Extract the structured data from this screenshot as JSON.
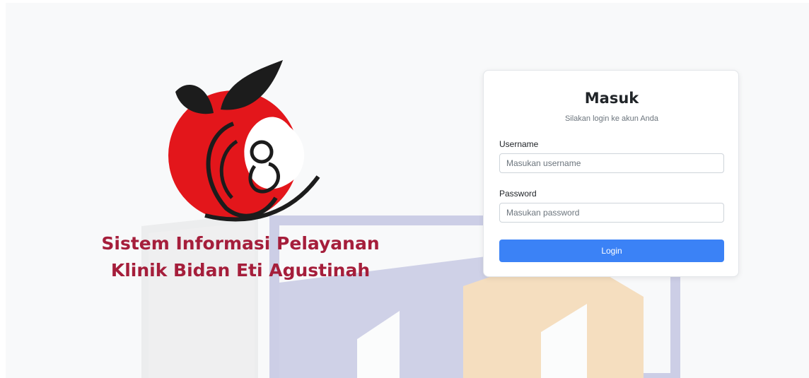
{
  "branding": {
    "line1": "Sistem Informasi Pelayanan",
    "line2": "Klinik Bidan Eti Agustinah",
    "brand_color": "#a51e3b",
    "logo_red": "#e3161b",
    "logo_dark": "#1c1c1c"
  },
  "login": {
    "title": "Masuk",
    "subtitle": "Silakan login ke akun Anda",
    "username_label": "Username",
    "username_placeholder": "Masukan username",
    "password_label": "Password",
    "password_placeholder": "Masukan password",
    "button_label": "Login",
    "button_color": "#3b82f6"
  },
  "watermark": {
    "colors": [
      "#d9d9d9",
      "#a9acd6",
      "#f3c88f"
    ]
  }
}
